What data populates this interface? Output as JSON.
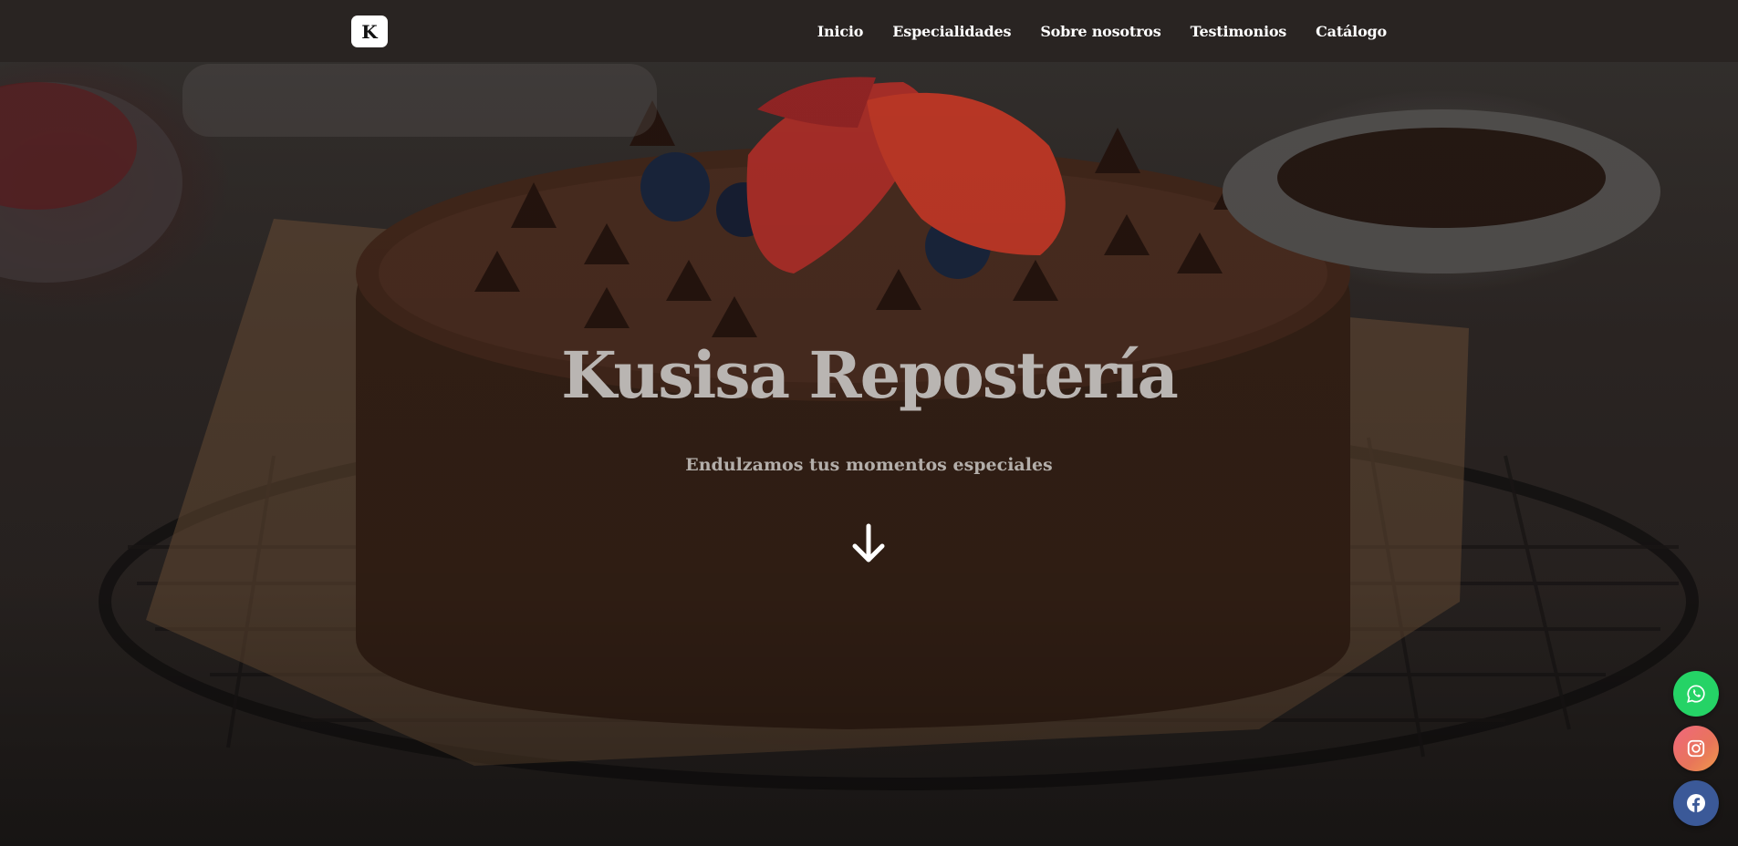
{
  "brand": {
    "logo_letter": "K"
  },
  "nav": {
    "items": [
      {
        "label": "Inicio"
      },
      {
        "label": "Especialidades"
      },
      {
        "label": "Sobre nosotros"
      },
      {
        "label": "Testimonios"
      },
      {
        "label": "Catálogo"
      }
    ]
  },
  "hero": {
    "title": "Kusisa Repostería",
    "subtitle": "Endulzamos tus momentos especiales",
    "scroll_icon": "arrow-down-icon"
  },
  "social": {
    "whatsapp_icon": "whatsapp-icon",
    "instagram_icon": "instagram-icon",
    "facebook_icon": "facebook-icon",
    "whatsapp_color": "#25d366",
    "facebook_color": "#3b5998"
  }
}
